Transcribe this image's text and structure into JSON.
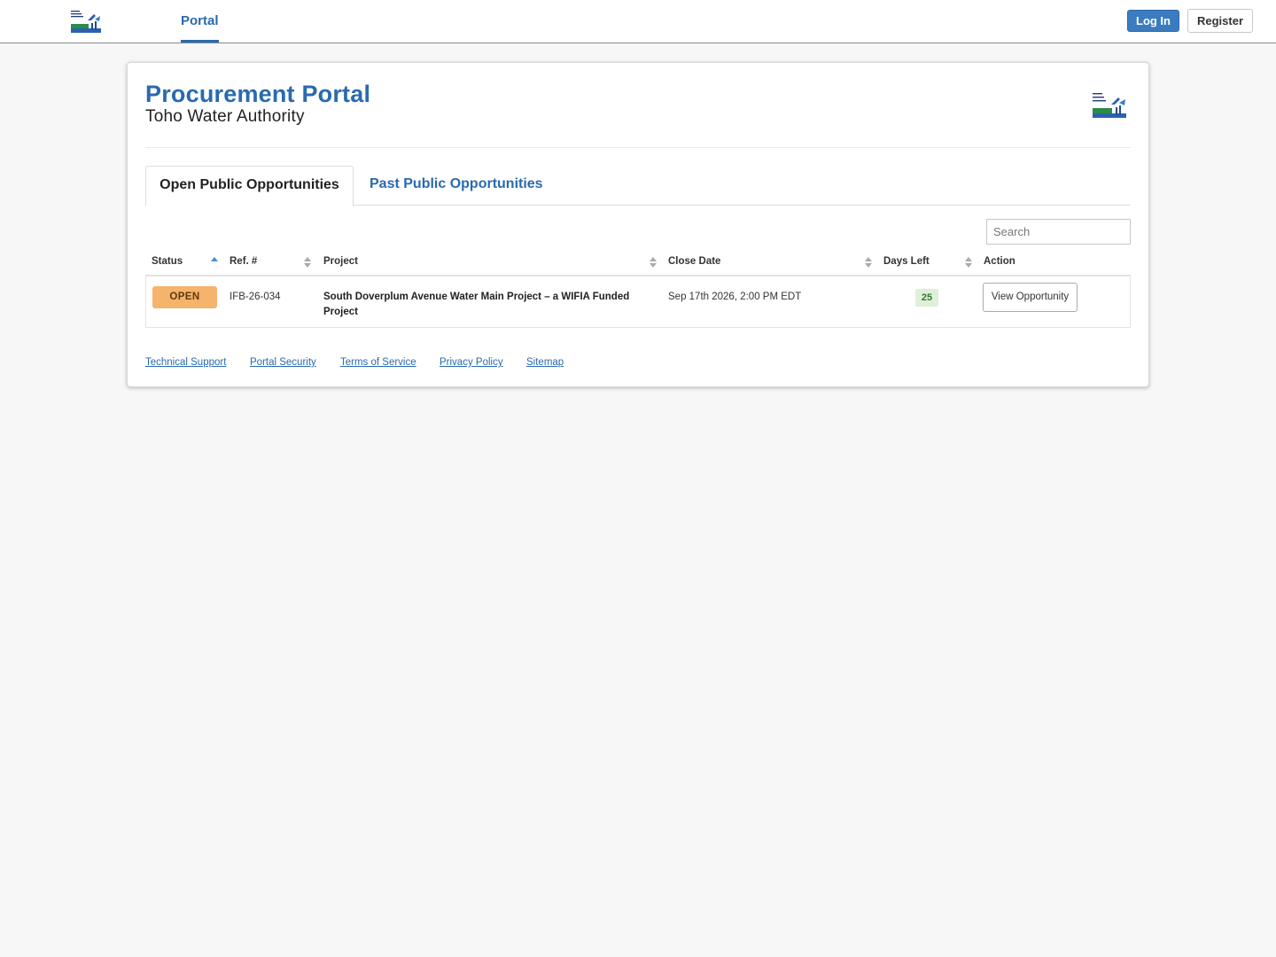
{
  "navbar": {
    "logo_icon": "toho-water-authority-logo",
    "nav_link": "Portal",
    "login_label": "Log In",
    "register_label": "Register"
  },
  "header": {
    "title": "Procurement Portal",
    "subtitle": "Toho Water Authority",
    "logo_icon": "toho-water-authority-logo"
  },
  "tabs": [
    {
      "label": "Open Public Opportunities",
      "active": true
    },
    {
      "label": "Past Public Opportunities",
      "active": false
    }
  ],
  "search": {
    "placeholder": "Search",
    "value": ""
  },
  "table": {
    "columns": [
      {
        "label": "Status",
        "sort": "ascending"
      },
      {
        "label": "Ref. #",
        "sort": "none"
      },
      {
        "label": "Project",
        "sort": "none"
      },
      {
        "label": "Close Date",
        "sort": "none"
      },
      {
        "label": "Days Left",
        "sort": "none"
      },
      {
        "label": "Action",
        "sort": "disabled"
      }
    ],
    "rows": [
      {
        "status": "OPEN",
        "ref": "IFB-26-034",
        "project": "South Doverplum Avenue Water Main Project – a WIFIA Funded Project",
        "close_date": "Sep 17th 2026, 2:00 PM EDT",
        "days_left": "25",
        "action": "View Opportunity"
      }
    ]
  },
  "footer": {
    "links": [
      "Technical Support",
      "Portal Security",
      "Terms of Service",
      "Privacy Policy",
      "Sitemap"
    ]
  },
  "colors": {
    "brand_blue": "#2a6aad",
    "login_button": "#3b7bbf",
    "status_open": "#f6b36b",
    "days_left_bg": "#dff0d8",
    "days_left_text": "#2f7a2f",
    "page_background": "#f7f7f7"
  }
}
